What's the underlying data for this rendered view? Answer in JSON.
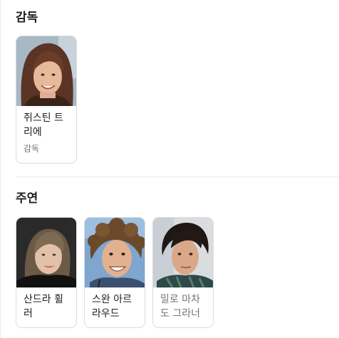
{
  "director_section": {
    "title": "감독",
    "people": [
      {
        "name_line1": "쥐스틴 트",
        "name_line2": "리에",
        "role": "감독",
        "photo": "portrait-woman-brown-hair"
      }
    ]
  },
  "cast_section": {
    "title": "주연",
    "people": [
      {
        "name_line1": "산드라 휠",
        "name_line2": "러",
        "photo": "portrait-woman-blonde"
      },
      {
        "name_line1": "스완 아르",
        "name_line2": "라우드",
        "photo": "portrait-man-curly-hair"
      },
      {
        "name_line1": "밀로 마차",
        "name_line2": "도 그라너",
        "photo": "portrait-boy-dark-hair"
      }
    ]
  }
}
